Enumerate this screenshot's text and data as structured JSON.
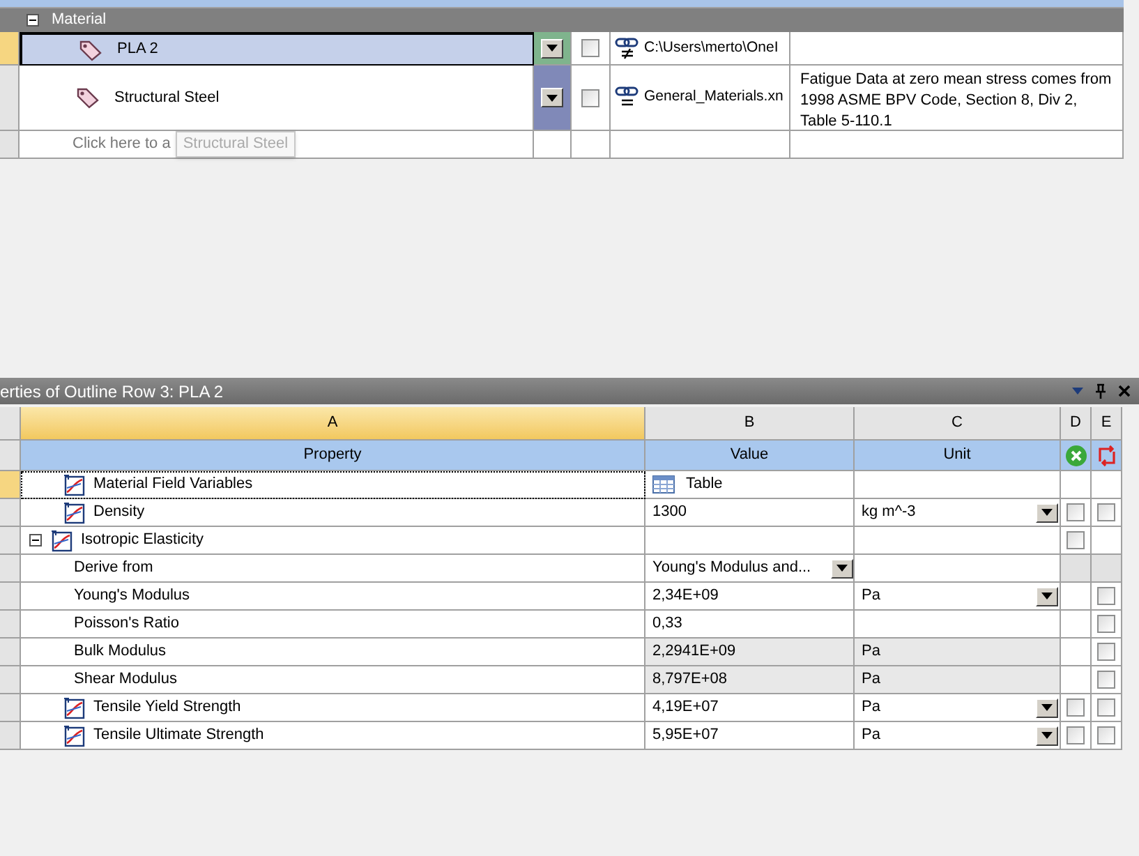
{
  "outline": {
    "group": {
      "label": "Material",
      "expanded": true
    },
    "materials": [
      {
        "name": "PLA 2",
        "selected": true,
        "checked": false,
        "source": "C:\\Users\\merto\\OneI",
        "source_synced": false
      },
      {
        "name": "Structural Steel",
        "selected": false,
        "checked": false,
        "source": "General_Materials.xn",
        "source_synced": true,
        "description": "Fatigue Data at zero mean stress comes from 1998 ASME BPV Code, Section 8, Div 2, Table 5-110.1"
      }
    ],
    "add_row": {
      "placeholder": "Click here to a",
      "tooltip": "Structural Steel"
    }
  },
  "properties": {
    "title": "erties of Outline Row 3: PLA 2",
    "column_letters": [
      "A",
      "B",
      "C",
      "D",
      "E"
    ],
    "column_labels": [
      "Property",
      "Value",
      "Unit"
    ],
    "rows": [
      {
        "name": "Material Field Variables",
        "selected": true,
        "value": "Table",
        "kind": "table",
        "unit_dropdown": false
      },
      {
        "name": "Density",
        "selected": false,
        "value": "1300",
        "kind": "text",
        "unit": "kg m^-3",
        "unit_dropdown": true,
        "d": {
          "checked": false
        },
        "e": {
          "checked": false
        }
      },
      {
        "name": "Isotropic Elasticity",
        "selected": false,
        "expanded": true,
        "kind": "text",
        "unit_dropdown": false,
        "d": {
          "checked": false
        },
        "children": [
          {
            "name": "Derive from",
            "selected": false,
            "value": "Young's Modulus and...",
            "kind": "dropdown",
            "unit_dropdown": false,
            "locked": true
          },
          {
            "name": "Young's Modulus",
            "selected": false,
            "value": "2,34E+09",
            "kind": "text",
            "unit": "Pa",
            "unit_dropdown": true,
            "e": {
              "checked": false
            }
          },
          {
            "name": "Poisson's Ratio",
            "selected": false,
            "value": "0,33",
            "kind": "text",
            "unit_dropdown": false,
            "e": {
              "checked": false
            }
          },
          {
            "name": "Bulk Modulus",
            "selected": false,
            "value": "2,2941E+09",
            "kind": "text",
            "readonly": true,
            "unit": "Pa",
            "unit_dropdown": false,
            "e": {
              "checked": false
            }
          },
          {
            "name": "Shear Modulus",
            "selected": false,
            "value": "8,797E+08",
            "kind": "text",
            "readonly": true,
            "unit": "Pa",
            "unit_dropdown": false,
            "e": {
              "checked": false
            }
          }
        ]
      },
      {
        "name": "Tensile Yield Strength",
        "selected": false,
        "value": "4,19E+07",
        "kind": "text",
        "unit": "Pa",
        "unit_dropdown": true,
        "d": {
          "checked": false
        },
        "e": {
          "checked": false
        }
      },
      {
        "name": "Tensile Ultimate Strength",
        "selected": false,
        "value": "5,95E+07",
        "kind": "text",
        "unit": "Pa",
        "unit_dropdown": true,
        "d": {
          "checked": false
        },
        "e": {
          "checked": false
        }
      }
    ]
  }
}
